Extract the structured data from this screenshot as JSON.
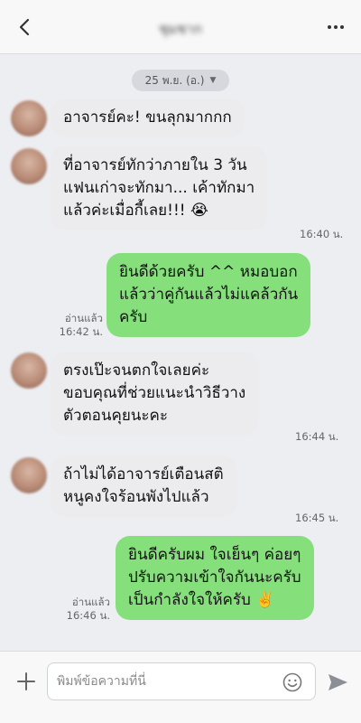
{
  "header": {
    "title": "ชุมชาก"
  },
  "date_divider": {
    "label": "25 พ.ย. (อ.)"
  },
  "messages": [
    {
      "lines": [
        "อาจารย์คะ! ขนลุกมากกก"
      ]
    },
    {
      "lines": [
        "ที่อาจารย์ทักว่าภายใน 3 วัน",
        "แฟนเก่าจะทักมา... เค้าทักมา",
        "แล้วค่ะเมื่อกี้เลย!!! 😭"
      ],
      "time": "16:40 น."
    },
    {
      "lines": [
        "ยินดีด้วยครับ ^^ หมอบอก",
        "แล้วว่าคู่กันแล้วไม่แคล้วกัน",
        "ครับ"
      ],
      "read": "อ่านแล้ว",
      "time": "16:42 น."
    },
    {
      "lines": [
        "ตรงเป๊ะจนตกใจเลยค่ะ",
        "ขอบคุณที่ช่วยแนะนำวิธีวาง",
        "ตัวตอนคุยนะคะ"
      ],
      "time": "16:44 น."
    },
    {
      "lines": [
        "ถ้าไม่ได้อาจารย์เตือนสติ",
        "หนูคงใจร้อนพังไปแล้ว"
      ],
      "time": "16:45 น."
    },
    {
      "lines": [
        "ยินดีครับผม ใจเย็นๆ ค่อยๆ",
        "ปรับความเข้าใจกันนะครับ",
        "เป็นกำลังใจให้ครับ ✌️"
      ],
      "read": "อ่านแล้ว",
      "time": "16:46 น."
    }
  ],
  "input": {
    "placeholder": "พิมพ์ข้อความที่นี่",
    "value": ""
  },
  "icons": {
    "back": "chevron-left-icon",
    "menu": "more-dots-icon",
    "add": "plus-icon",
    "emoji": "smiley-icon",
    "send": "send-arrow-icon"
  },
  "colors": {
    "background": "#edeef2",
    "incoming_bubble": "#ececef",
    "outgoing_bubble": "#85e07b",
    "header": "#f8f8f8"
  }
}
